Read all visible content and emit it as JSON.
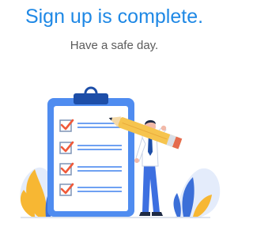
{
  "screen": {
    "title": "Sign up is complete.",
    "subtitle": "Have a safe day."
  },
  "colors": {
    "accent": "#1e88e5",
    "subtitle_text": "#5b5b5b",
    "clipboard_frame": "#4f8cf0",
    "paper": "#ffffff",
    "clip": "#1d4ea8",
    "line": "#6fa1f2",
    "checkbox_border": "#7d93b5",
    "checkmark": "#f05a3a",
    "pencil": "#f6c44e",
    "pencil_band": "#e56b4e",
    "person_shirt": "#ffffff",
    "person_pants": "#3d6fe0",
    "person_tie": "#1d4ea8",
    "person_skin": "#f2b9a8",
    "person_hair": "#1e2a44",
    "leaf_yellow": "#f7b733",
    "leaf_blue": "#3b6fd8",
    "blob_light_blue": "#e4ecfb",
    "ground_line": "#c9d3e3"
  },
  "illustration": {
    "icon": "signup-complete-illustration",
    "checklist_items": [
      {
        "checked": true
      },
      {
        "checked": true
      },
      {
        "checked": true
      },
      {
        "checked": true
      }
    ]
  }
}
